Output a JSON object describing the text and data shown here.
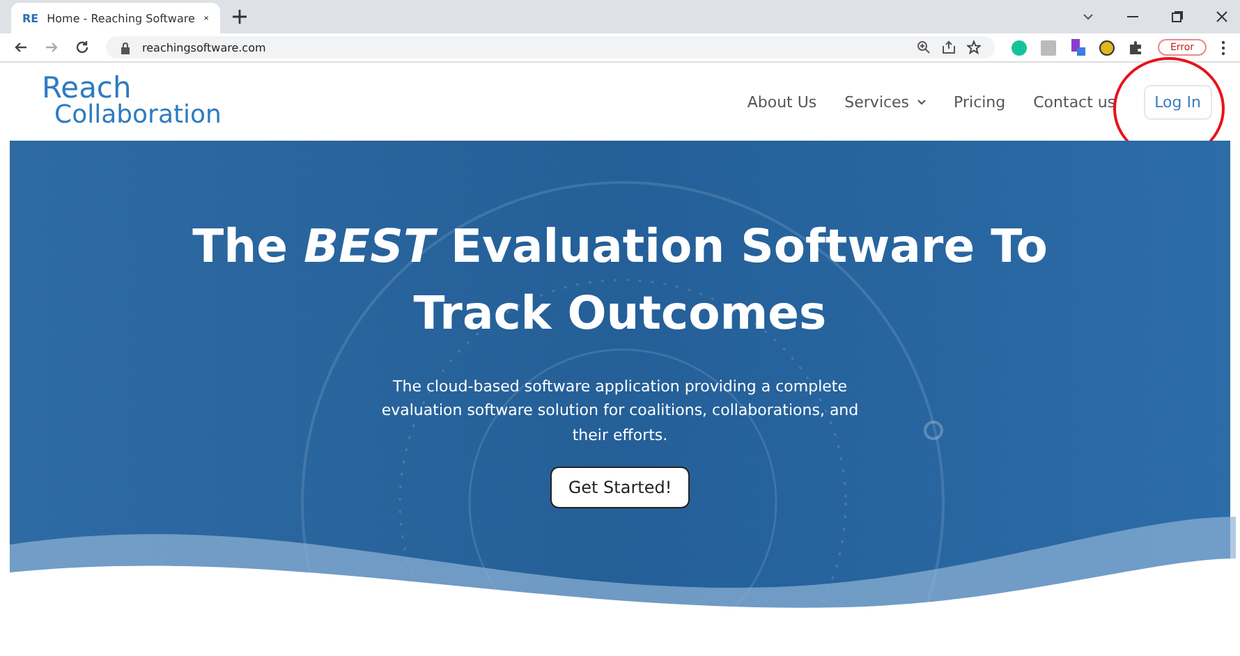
{
  "browser": {
    "tab": {
      "favicon": "RE",
      "title": "Home - Reaching Software"
    },
    "url": "reachingsoftware.com",
    "error_badge": "Error"
  },
  "site": {
    "logo": [
      "Reach",
      "Collaboration"
    ],
    "nav": [
      {
        "label": "About Us",
        "dropdown": false
      },
      {
        "label": "Services",
        "dropdown": true
      },
      {
        "label": "Pricing",
        "dropdown": false
      },
      {
        "label": "Contact us",
        "dropdown": false
      }
    ],
    "login": "Log In",
    "login_highlighted": true
  },
  "hero": {
    "title": "The *BEST* Evaluation Software To Track Outcomes",
    "subtitle": "The cloud-based software application providing a complete evaluation software solution for coalitions, collaborations, and their efforts.",
    "cta": "Get Started!"
  }
}
